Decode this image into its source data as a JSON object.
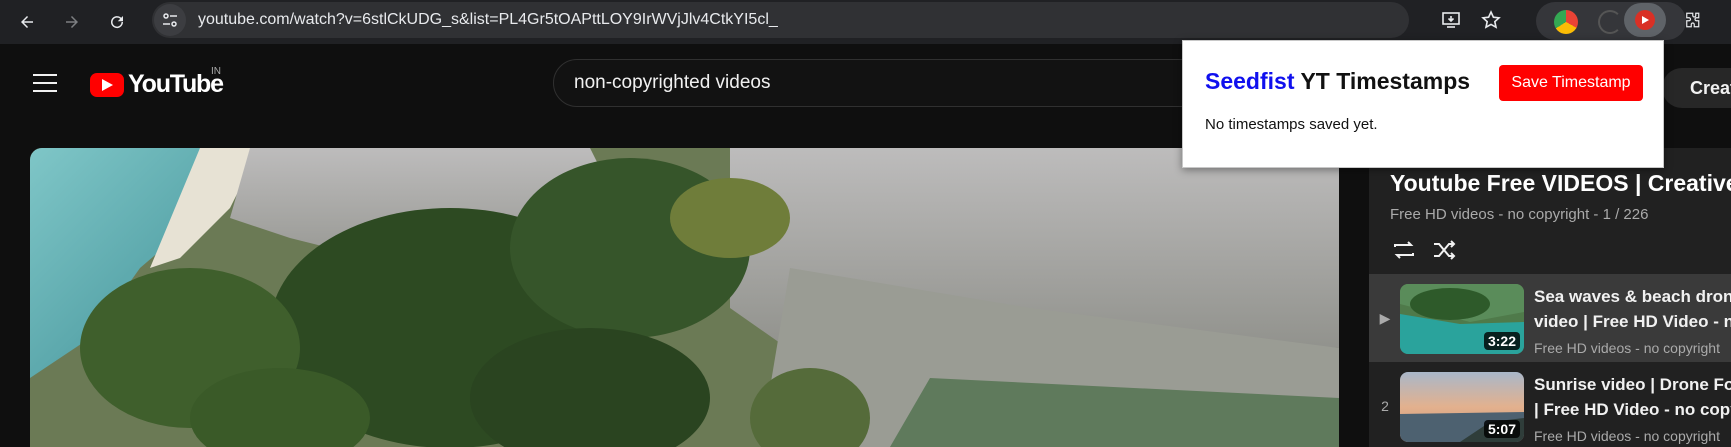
{
  "browser": {
    "url": "youtube.com/watch?v=6stlCkUDG_s&list=PL4Gr5tOAPttLOY9IrWVjJlv4CtkYI5cl_"
  },
  "youtube": {
    "logo_text": "YouTube",
    "region": "IN",
    "search_value": "non-copyrighted videos",
    "create_label": "Create"
  },
  "playlist": {
    "title": "Youtube Free VIDEOS | Creative",
    "subtitle": "Free HD videos - no copyright - 1 / 226",
    "items": [
      {
        "index": "▶",
        "title_line1": "Sea waves & beach dron",
        "title_line2": "video | Free HD Video - n",
        "channel": "Free HD videos - no copyright",
        "duration": "3:22"
      },
      {
        "index": "2",
        "title_line1": "Sunrise video | Drone Foo",
        "title_line2": "| Free HD Video - no copy",
        "channel": "Free HD videos - no copyright",
        "duration": "5:07"
      }
    ]
  },
  "extension_popup": {
    "brand": "Seedfist",
    "title_rest": " YT Timestamps",
    "save_label": "Save Timestamp",
    "empty_text": "No timestamps saved yet."
  },
  "colors": {
    "brand_blue": "#1010ee",
    "save_red": "#ff0000",
    "youtube_red": "#ff0000"
  }
}
